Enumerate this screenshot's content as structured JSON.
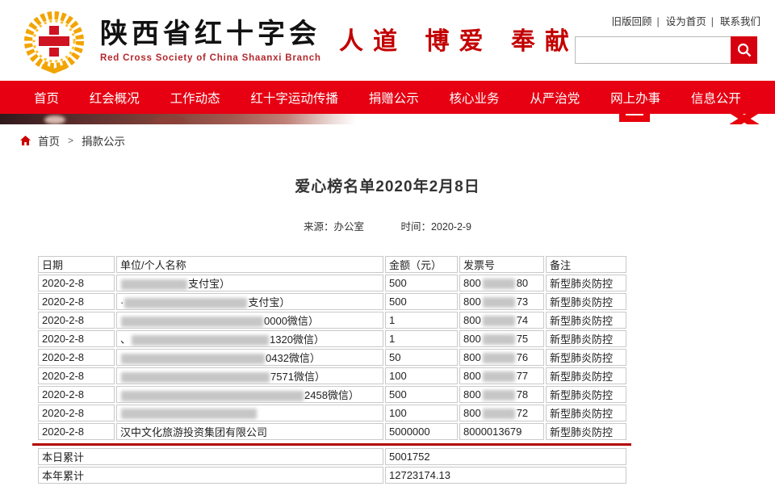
{
  "header": {
    "site_name": "陕西省红十字会",
    "site_name_en": "Red Cross Society of China Shaanxi Branch",
    "slogan": "人道 博爱 奉献",
    "top_links": [
      "旧版回顾",
      "设为首页",
      "联系我们"
    ],
    "search": {
      "placeholder": "",
      "value": ""
    }
  },
  "nav": {
    "items": [
      "首页",
      "红会概况",
      "工作动态",
      "红十字运动传播",
      "捐赠公示",
      "核心业务",
      "从严治党",
      "网上办事",
      "信息公开"
    ]
  },
  "breadcrumb": {
    "home": "首页",
    "separator": ">",
    "current": "捐款公示"
  },
  "article": {
    "title": "爱心榜名单2020年2月8日",
    "source_label": "来源：办公室",
    "time_label": "时间：2020-2-9"
  },
  "table": {
    "headers": [
      "日期",
      "单位/个人名称",
      "金额（元）",
      "发票号",
      "备注"
    ],
    "rows": [
      {
        "date": "2020-2-8",
        "name_prefix": "",
        "name_blur": 82,
        "name_suffix": "支付宝）",
        "amount": "500",
        "inv_prefix": "800",
        "inv_blur": 40,
        "inv_suffix": "80",
        "note": "新型肺炎防控"
      },
      {
        "date": "2020-2-8",
        "name_prefix": "·",
        "name_blur": 152,
        "name_suffix": "支付宝）",
        "amount": "500",
        "inv_prefix": "800",
        "inv_blur": 40,
        "inv_suffix": "73",
        "note": "新型肺炎防控"
      },
      {
        "date": "2020-2-8",
        "name_prefix": "",
        "name_blur": 176,
        "name_suffix": "0000微信）",
        "amount": "1",
        "inv_prefix": "800",
        "inv_blur": 40,
        "inv_suffix": "74",
        "note": "新型肺炎防控"
      },
      {
        "date": "2020-2-8",
        "name_prefix": "、",
        "name_blur": 170,
        "name_suffix": "1320微信）",
        "amount": "1",
        "inv_prefix": "800",
        "inv_blur": 40,
        "inv_suffix": "75",
        "note": "新型肺炎防控"
      },
      {
        "date": "2020-2-8",
        "name_prefix": "",
        "name_blur": 178,
        "name_suffix": "0432微信）",
        "amount": "50",
        "inv_prefix": "800",
        "inv_blur": 40,
        "inv_suffix": "76",
        "note": "新型肺炎防控"
      },
      {
        "date": "2020-2-8",
        "name_prefix": "",
        "name_blur": 184,
        "name_suffix": "7571微信）",
        "amount": "100",
        "inv_prefix": "800",
        "inv_blur": 40,
        "inv_suffix": "77",
        "note": "新型肺炎防控"
      },
      {
        "date": "2020-2-8",
        "name_prefix": "",
        "name_blur": 226,
        "name_suffix": "2458微信）",
        "amount": "500",
        "inv_prefix": "800",
        "inv_blur": 40,
        "inv_suffix": "78",
        "note": "新型肺炎防控"
      },
      {
        "date": "2020-2-8",
        "name_prefix": "",
        "name_blur": 168,
        "name_suffix": "",
        "amount": "100",
        "inv_prefix": "800",
        "inv_blur": 40,
        "inv_suffix": "72",
        "note": "新型肺炎防控"
      },
      {
        "date": "2020-2-8",
        "name_prefix": "汉中文化旅游投资集团有限公司",
        "name_blur": 0,
        "name_suffix": "",
        "amount": "5000000",
        "inv_prefix": "8000013679",
        "inv_blur": 0,
        "inv_suffix": "",
        "note": "新型肺炎防控"
      }
    ],
    "summary": [
      {
        "label": "本日累计",
        "value": "5001752"
      },
      {
        "label": "本年累计",
        "value": "12723174.13"
      }
    ]
  },
  "colors": {
    "nav_red": "#e60012",
    "button_red": "#d7000f",
    "slogan_red": "#c30000",
    "divider_red": "#b30000",
    "wreath_gold": "#f2a400",
    "cross_red": "#cf1322"
  }
}
